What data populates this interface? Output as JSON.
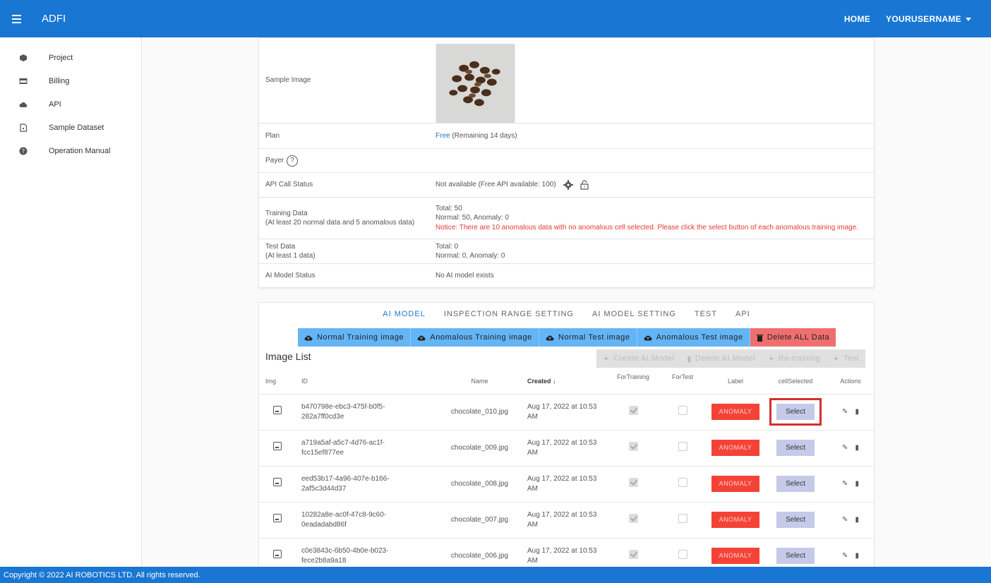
{
  "appbar": {
    "brand": "ADFI",
    "home": "HOME",
    "user": "YOURUSERNAME"
  },
  "sidebar": {
    "items": [
      {
        "label": "Project",
        "icon": "cube-icon"
      },
      {
        "label": "Billing",
        "icon": "credit-card-icon"
      },
      {
        "label": "API",
        "icon": "cloud-icon"
      },
      {
        "label": "Sample Dataset",
        "icon": "file-icon"
      },
      {
        "label": "Operation Manual",
        "icon": "help-icon"
      }
    ]
  },
  "info": {
    "sample_image": "Sample Image",
    "plan_label": "Plan",
    "plan_link": "Free",
    "plan_rest": " (Remaining 14 days)",
    "payer_label": "Payer",
    "payer_help": "?",
    "api_label": "API Call Status",
    "api_value": "Not available (Free API available: 100)",
    "training_label_1": "Training Data",
    "training_label_2": "(At least 20 normal data and 5 anomalous data)",
    "training_total": "Total: 50",
    "training_breakdown": "Normal: 50, Anomaly: 0",
    "training_notice": "Notice: There are 10 anomalous data with no anomalous cell selected. Please click the select button of each anomalous training image.",
    "test_label_1": "Test Data",
    "test_label_2": "(At least 1 data)",
    "test_total": "Total: 0",
    "test_breakdown": "Normal: 0, Anomaly: 0",
    "model_label": "AI Model Status",
    "model_value": "No AI model exists"
  },
  "tabs": [
    "AI MODEL",
    "INSPECTION RANGE SETTING",
    "AI MODEL SETTING",
    "TEST",
    "API"
  ],
  "uploads": [
    "Normal Training image",
    "Anomalous Training image",
    "Normal Test image",
    "Anomalous Test image",
    "Delete ALL Data"
  ],
  "image_list_title": "Image List",
  "actions": [
    "Create AI Model",
    "Delete AI Model",
    "Re-training",
    "Test"
  ],
  "table": {
    "headers": [
      "Img",
      "ID",
      "Name",
      "Created",
      "ForTraining",
      "ForTest",
      "Label",
      "cellSelected",
      "Actions"
    ],
    "rows": [
      {
        "id1": "b470798e-ebc3-475f-b0f5-",
        "id2": "282a7ff0cd3e",
        "name": "chocolate_010.jpg",
        "c1": "Aug 17, 2022 at 10:53",
        "c2": "AM",
        "label": "ANOMALY",
        "select": "Select"
      },
      {
        "id1": "a719a5af-a5c7-4d76-ac1f-",
        "id2": "fcc15ef877ee",
        "name": "chocolate_009.jpg",
        "c1": "Aug 17, 2022 at 10:53",
        "c2": "AM",
        "label": "ANOMALY",
        "select": "Select"
      },
      {
        "id1": "eed53b17-4a96-407e-b166-",
        "id2": "2af5c3d44d37",
        "name": "chocolate_008.jpg",
        "c1": "Aug 17, 2022 at 10:53",
        "c2": "AM",
        "label": "ANOMALY",
        "select": "Select"
      },
      {
        "id1": "10282a8e-ac0f-47c8-9c60-",
        "id2": "0eadadabd86f",
        "name": "chocolate_007.jpg",
        "c1": "Aug 17, 2022 at 10:53",
        "c2": "AM",
        "label": "ANOMALY",
        "select": "Select"
      },
      {
        "id1": "c0e3843c-6b50-4b0e-b023-",
        "id2": "fece2b8a9a18",
        "name": "chocolate_006.jpg",
        "c1": "Aug 17, 2022 at 10:53",
        "c2": "AM",
        "label": "ANOMALY",
        "select": "Select"
      }
    ]
  },
  "footer": "Copyright © 2022 AI ROBOTICS LTD. All rights reserved.",
  "colors": {
    "primary": "#1976d2",
    "anomaly": "#f44336",
    "upload": "#64b5f6",
    "delete": "#ef6f6f"
  }
}
